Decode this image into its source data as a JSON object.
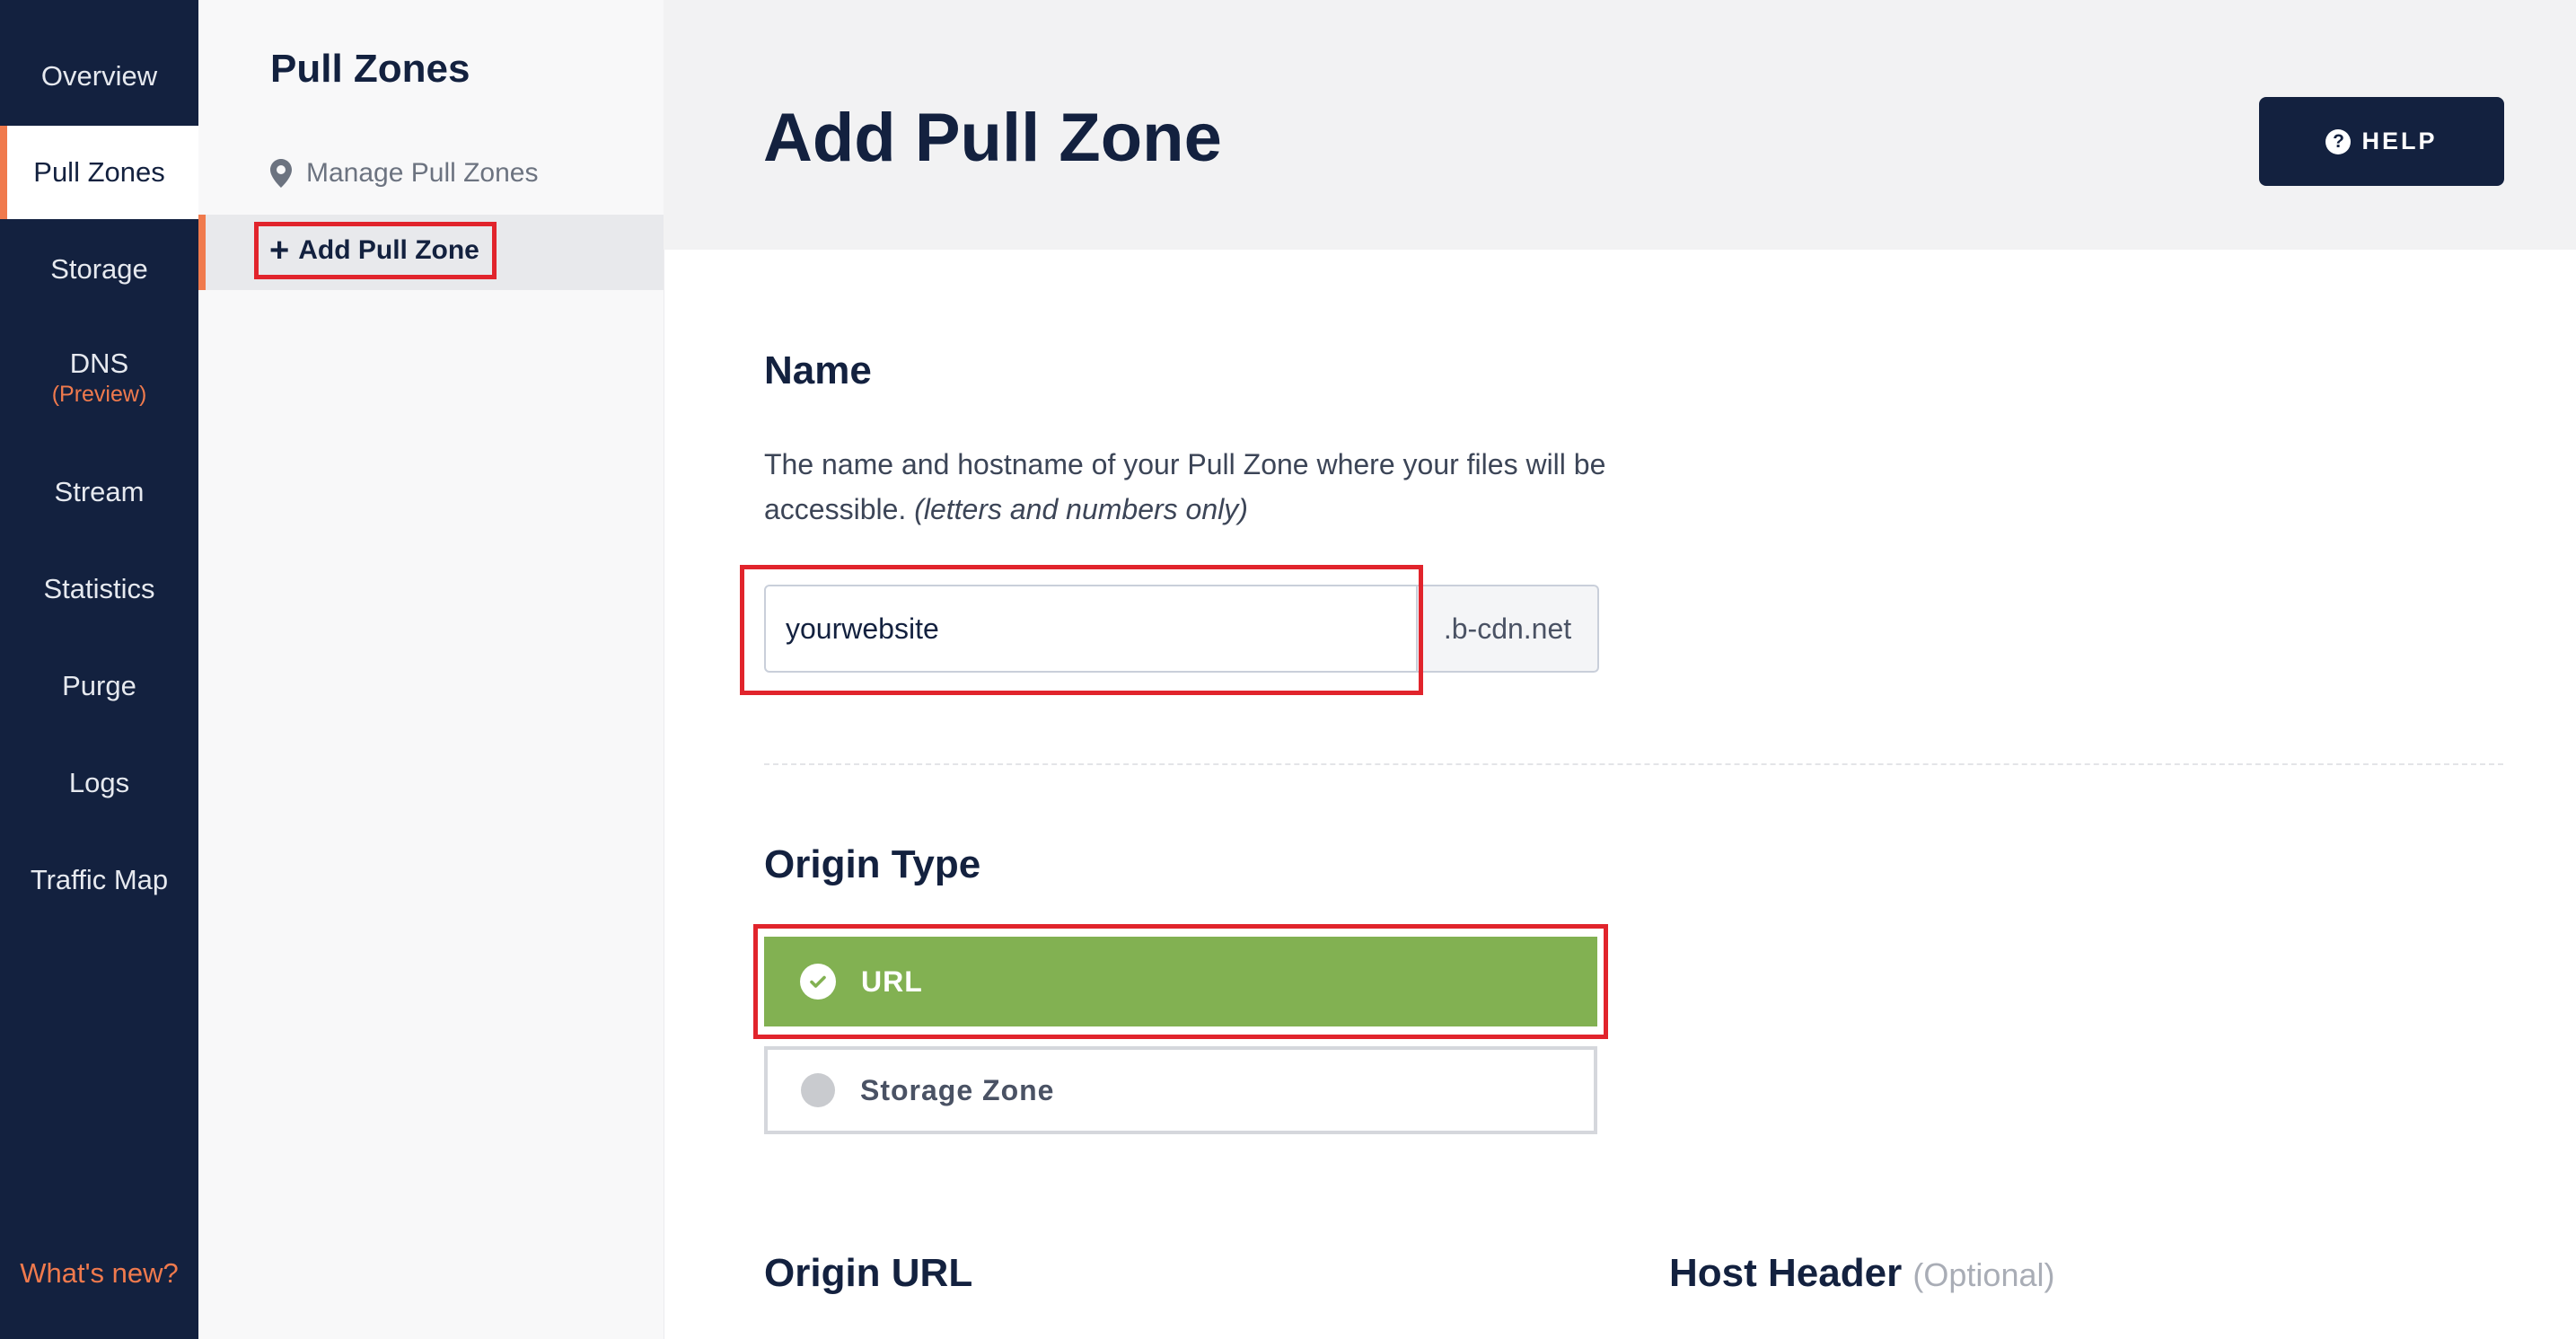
{
  "nav": {
    "items": [
      {
        "label": "Overview"
      },
      {
        "label": "Pull Zones",
        "active": true
      },
      {
        "label": "Storage"
      },
      {
        "label": "DNS",
        "sub": "(Preview)"
      },
      {
        "label": "Stream"
      },
      {
        "label": "Statistics"
      },
      {
        "label": "Purge"
      },
      {
        "label": "Logs"
      },
      {
        "label": "Traffic Map"
      }
    ],
    "whats_new": "What's new?"
  },
  "subnav": {
    "title": "Pull Zones",
    "manage": "Manage Pull Zones",
    "add": "Add Pull Zone"
  },
  "header": {
    "title": "Add Pull Zone",
    "help": "HELP"
  },
  "name_section": {
    "title": "Name",
    "description": "The name and hostname of your Pull Zone where your files will be accessible.",
    "description_note": "(letters and numbers only)",
    "input_value": "yourwebsite",
    "suffix": ".b-cdn.net"
  },
  "origin_type": {
    "title": "Origin Type",
    "options": [
      {
        "label": "URL",
        "selected": true
      },
      {
        "label": "Storage Zone",
        "selected": false
      }
    ]
  },
  "origin_url": {
    "title": "Origin URL"
  },
  "host_header": {
    "title": "Host Header",
    "optional": "(Optional)"
  },
  "colors": {
    "navy": "#13213f",
    "accent": "#f07a4d",
    "selected_green": "#82b152",
    "highlight_red": "#e1242c"
  }
}
